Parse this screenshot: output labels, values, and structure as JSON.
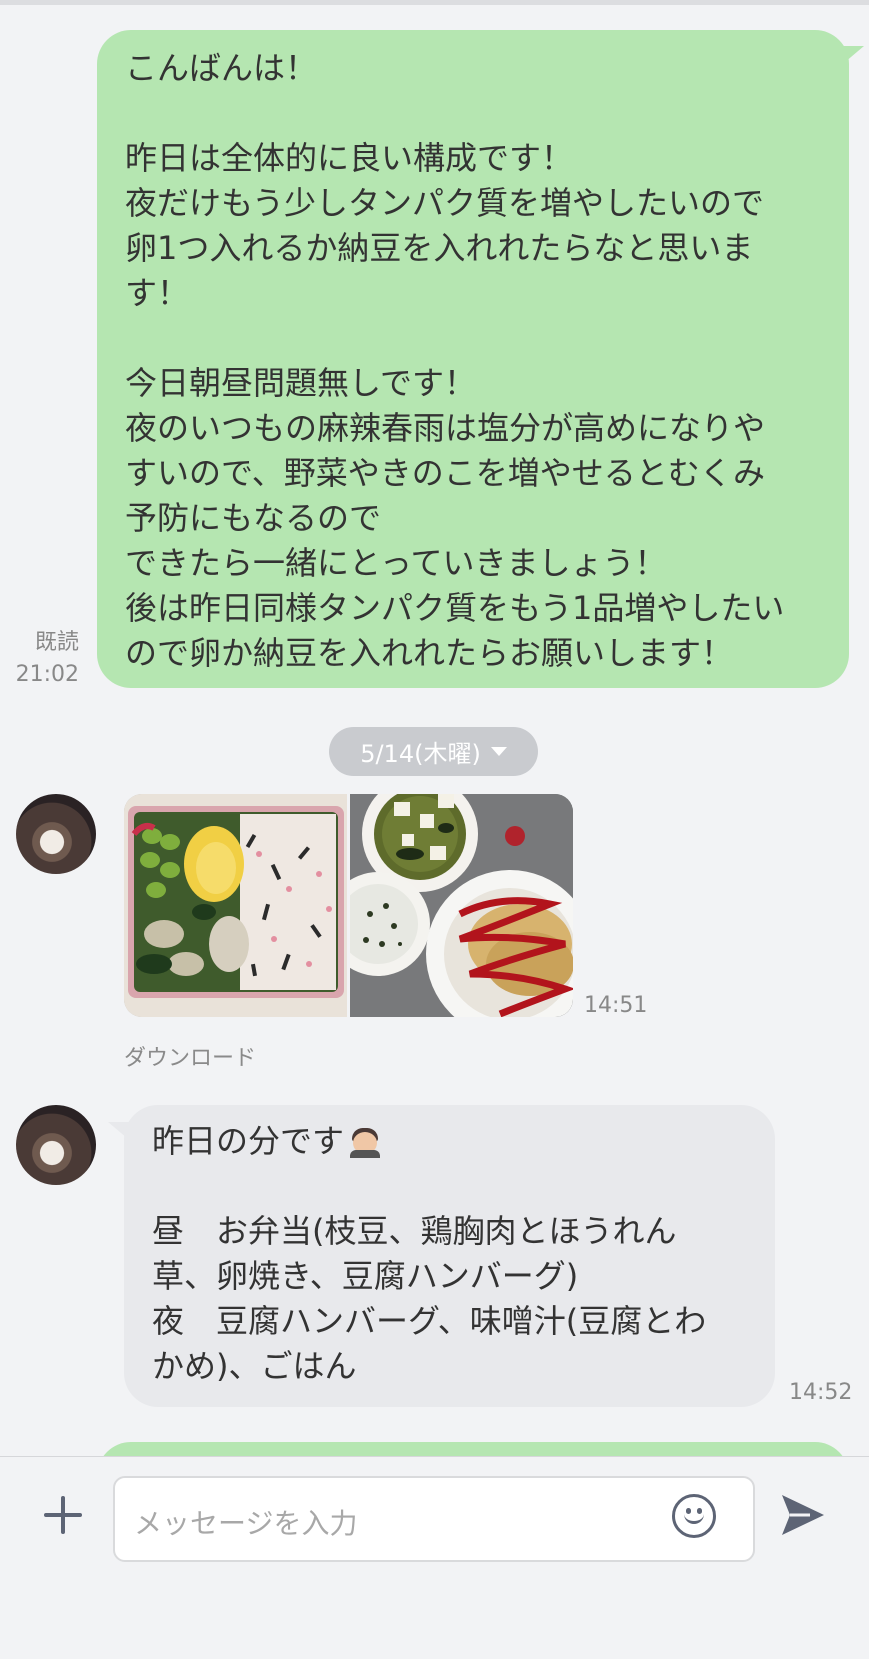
{
  "outgoing_message": {
    "lines": [
      "こんばんは！",
      "",
      "昨日は全体的に良い構成です！",
      "夜だけもう少しタンパク質を増やしたいので",
      "卵1つ入れるか納豆を入れれたらなと思いま",
      "す！",
      "",
      "今日朝昼問題無しです！",
      "夜のいつもの麻辣春雨は塩分が高めになりや",
      "すいので、野菜やきのこを増やせるとむくみ",
      "予防にもなるので",
      "できたら一緒にとっていきましょう！",
      "後は昨日同様タンパク質をもう1品増やしたい",
      "ので卵か納豆を入れれたらお願いします！"
    ],
    "read_label": "既読",
    "time": "21:02"
  },
  "date_separator": {
    "label": "5/14(木曜)"
  },
  "photo_message": {
    "time": "14:51",
    "download_label": "ダウンロード"
  },
  "incoming_message": {
    "first_line": "昨日の分です",
    "lines": [
      "",
      "昼　お弁当(枝豆、鶏胸肉とほうれん",
      "草、卵焼き、豆腐ハンバーグ)",
      "夜　豆腐ハンバーグ、味噌汁(豆腐とわ",
      "かめ)、ごはん"
    ],
    "time": "14:52"
  },
  "input": {
    "placeholder": "メッセージを入力"
  },
  "colors": {
    "outgoing_bubble": "#b5e6b1",
    "incoming_bubble": "#e8e9ec",
    "background": "#f2f3f5",
    "icon": "#5d6475"
  },
  "icons": [
    "plus-icon",
    "emoji-icon",
    "send-icon",
    "chevron-down-icon"
  ]
}
